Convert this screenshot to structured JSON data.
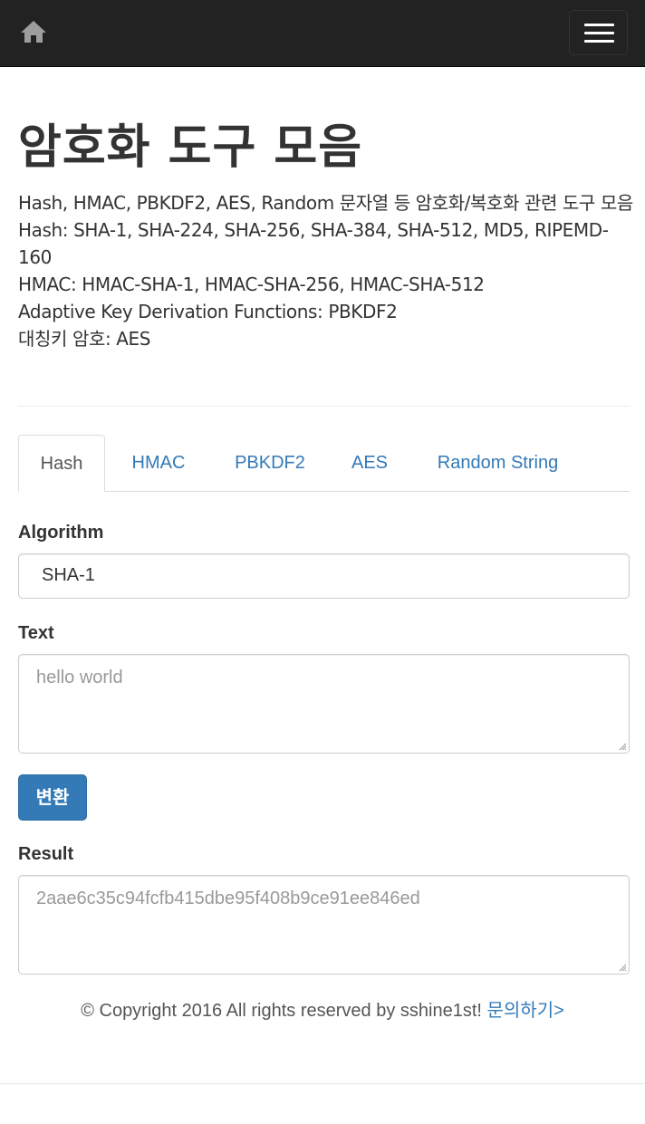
{
  "navbar": {
    "home_icon": "home-icon",
    "menu_icon": "hamburger-menu-icon"
  },
  "header": {
    "title": "암호화 도구 모음",
    "description_lines": [
      "Hash, HMAC, PBKDF2, AES, Random 문자열 등 암호화/복호화 관련 도구 모음",
      "Hash: SHA-1, SHA-224, SHA-256, SHA-384, SHA-512, MD5, RIPEMD-160",
      "HMAC: HMAC-SHA-1, HMAC-SHA-256, HMAC-SHA-512",
      "Adaptive Key Derivation Functions: PBKDF2",
      "대칭키 암호: AES"
    ]
  },
  "tabs": [
    {
      "label": "Hash",
      "active": true
    },
    {
      "label": "HMAC",
      "active": false
    },
    {
      "label": "PBKDF2",
      "active": false
    },
    {
      "label": "AES",
      "active": false
    },
    {
      "label": "Random String",
      "active": false
    }
  ],
  "form": {
    "algorithm_label": "Algorithm",
    "algorithm_value": "SHA-1",
    "text_label": "Text",
    "text_placeholder": "hello world",
    "submit_label": "변환",
    "result_label": "Result",
    "result_value": "2aae6c35c94fcfb415dbe95f408b9ce91ee846ed"
  },
  "footer": {
    "copyright": "© Copyright 2016 All rights reserved by sshine1st!",
    "contact_link": "문의하기>"
  },
  "colors": {
    "navbar_bg": "#222222",
    "link": "#337ab7",
    "primary_button": "#337ab7"
  }
}
